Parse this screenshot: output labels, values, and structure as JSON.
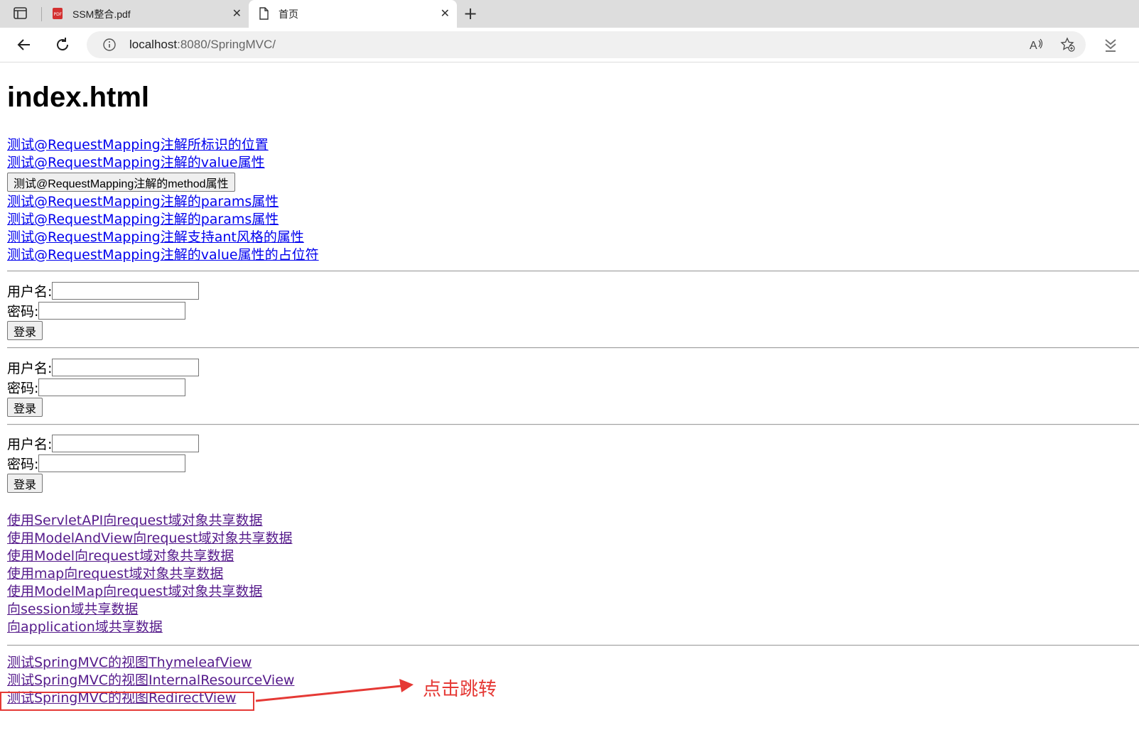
{
  "browser": {
    "tabs": [
      {
        "title": "SSM整合.pdf",
        "icon": "pdf-icon"
      },
      {
        "title": "首页",
        "icon": "page-icon"
      }
    ],
    "address": {
      "host": "localhost",
      "path": ":8080/SpringMVC/"
    }
  },
  "page": {
    "heading": "index.html",
    "mapping_links": [
      "测试@RequestMapping注解所标识的位置",
      "测试@RequestMapping注解的value属性"
    ],
    "method_button": "测试@RequestMapping注解的method属性",
    "mapping_links_2": [
      "测试@RequestMapping注解的params属性",
      "测试@RequestMapping注解的params属性",
      "测试@RequestMapping注解支持ant风格的属性",
      "测试@RequestMapping注解的value属性的占位符"
    ],
    "login_forms": [
      {
        "username_label": "用户名:",
        "password_label": "密码:",
        "submit": "登录"
      },
      {
        "username_label": "用户名:",
        "password_label": "密码:",
        "submit": "登录"
      },
      {
        "username_label": "用户名:",
        "password_label": "密码:",
        "submit": "登录"
      }
    ],
    "scope_links": [
      "使用ServletAPI向request域对象共享数据",
      "使用ModelAndView向request域对象共享数据",
      "使用Model向request域对象共享数据",
      "使用map向request域对象共享数据",
      "使用ModelMap向request域对象共享数据",
      "向session域共享数据",
      "向application域共享数据"
    ],
    "view_links": [
      "测试SpringMVC的视图ThymeleafView",
      "测试SpringMVC的视图InternalResourceView",
      "测试SpringMVC的视图RedirectView"
    ]
  },
  "annotation": {
    "text": "点击跳转",
    "color": "#e53935"
  },
  "colors": {
    "link": "#0000ee",
    "visited": "#551a8b"
  }
}
